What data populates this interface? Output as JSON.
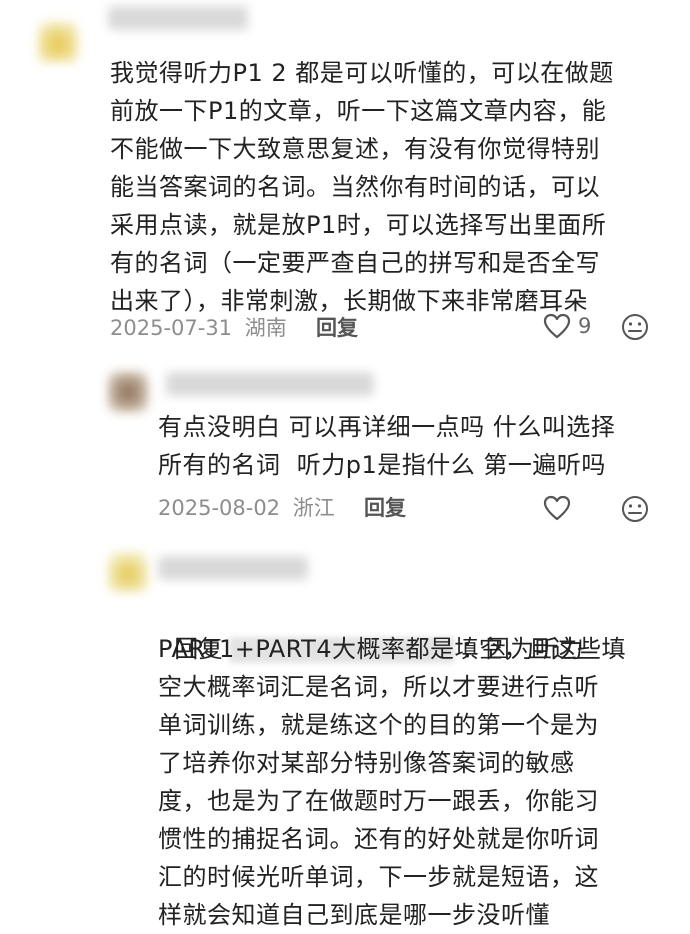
{
  "comments": [
    {
      "text": "我觉得听力P1 2 都是可以听懂的，可以在做题\n前放一下P1的文章，听一下这篇文章内容，能\n不能做一下大致意思复述，有没有你觉得特别\n能当答案词的名词。当然你有时间的话，可以\n采用点读，就是放P1时，可以选择写出里面所\n有的名词（一定要严查自己的拼写和是否全写\n出来了），非常刺激，长期做下来非常磨耳朵",
      "date": "2025-07-31",
      "location": "湖南",
      "reply_label": "回复",
      "likes": "9",
      "like_icon": "heart-icon",
      "dislike_icon": "meh-face-icon"
    },
    {
      "text": "有点没明白 可以再详细一点吗 什么叫选择\n所有的名词  听力p1是指什么 第一遍听吗",
      "date": "2025-08-02",
      "location": "浙江",
      "reply_label": "回复",
      "like_icon": "heart-icon",
      "dislike_icon": "meh-face-icon"
    },
    {
      "reply_prefix": "回复",
      "text_first": "：因为听力",
      "text_rest": "PART1+PART4大概率都是填空，且这些填\n空大概率词汇是名词，所以才要进行点听\n单词训练，就是练这个的目的第一个是为\n了培养你对某部分特别像答案词的敏感\n度，也是为了在做题时万一跟丢，你能习\n惯性的捕捉名词。还有的好处就是你听词\n汇的时候光听单词，下一步就是短语，这\n样就会知道自己到底是哪一步没听懂"
    }
  ]
}
